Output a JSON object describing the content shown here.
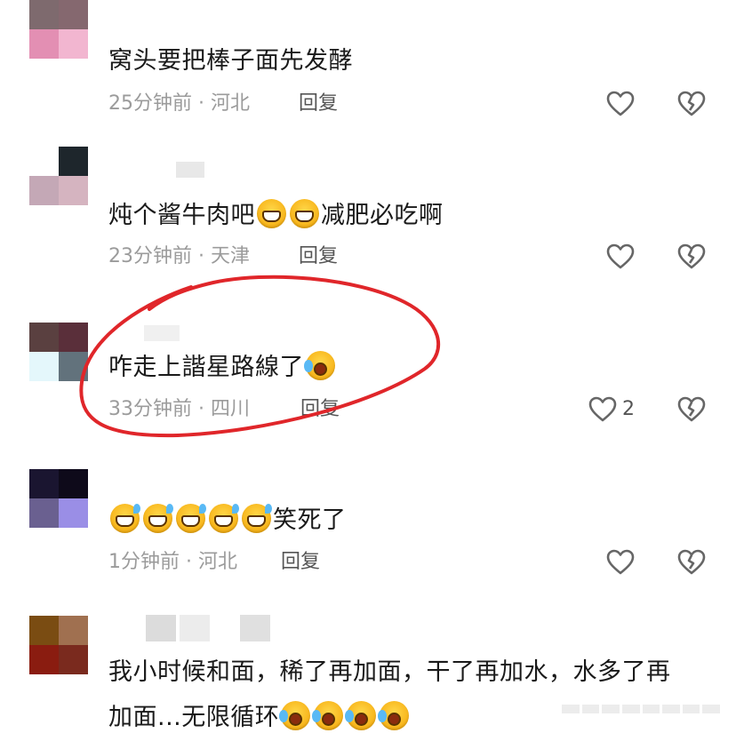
{
  "comments": [
    {
      "text": "窝头要把棒子面先发酵",
      "time": "25分钟前",
      "location": "河北",
      "reply": "回复",
      "likes": ""
    },
    {
      "text_before": "炖个酱牛肉吧",
      "text_after": "减肥必吃啊",
      "time": "23分钟前",
      "location": "天津",
      "reply": "回复",
      "likes": ""
    },
    {
      "text": "咋走上諧星路線了",
      "time": "33分钟前",
      "location": "四川",
      "reply": "回复",
      "likes": "2"
    },
    {
      "text_after": "笑死了",
      "time": "1分钟前",
      "location": "河北",
      "reply": "回复",
      "likes": ""
    },
    {
      "line1": "我小时候和面，稀了再加面，干了再加水，水多了再",
      "line2": "加面...无限循环"
    }
  ],
  "meta_separator": " · ",
  "icons": {
    "like": "heart-outline-icon",
    "dislike": "broken-heart-icon",
    "highlight": "red-circle-annotation"
  },
  "colors": {
    "annotation": "#e0262a",
    "meta": "#9b9b9b",
    "text": "#1a1a1a"
  }
}
